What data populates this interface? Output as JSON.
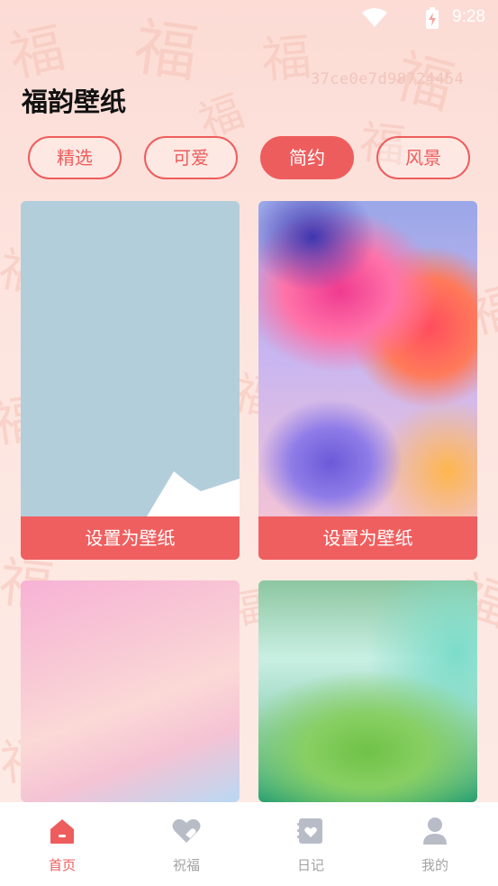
{
  "status_bar": {
    "time": "9:28"
  },
  "device_id": "37ce0e7d98724454",
  "page_title": "福韵壁纸",
  "tabs": [
    {
      "label": "精选",
      "active": false
    },
    {
      "label": "可爱",
      "active": false
    },
    {
      "label": "简约",
      "active": true
    },
    {
      "label": "风景",
      "active": false
    }
  ],
  "wallpapers": [
    {
      "set_label": "设置为壁纸"
    },
    {
      "set_label": "设置为壁纸"
    }
  ],
  "bottom_nav": [
    {
      "label": "首页",
      "icon": "home-icon",
      "active": true
    },
    {
      "label": "祝福",
      "icon": "heart-icon",
      "active": false
    },
    {
      "label": "日记",
      "icon": "diary-icon",
      "active": false
    },
    {
      "label": "我的",
      "icon": "user-icon",
      "active": false
    }
  ],
  "colors": {
    "accent": "#ee5d5d",
    "inactive": "#b8bcc6",
    "background": "#fde9e4"
  },
  "background_pattern_glyph": "福"
}
